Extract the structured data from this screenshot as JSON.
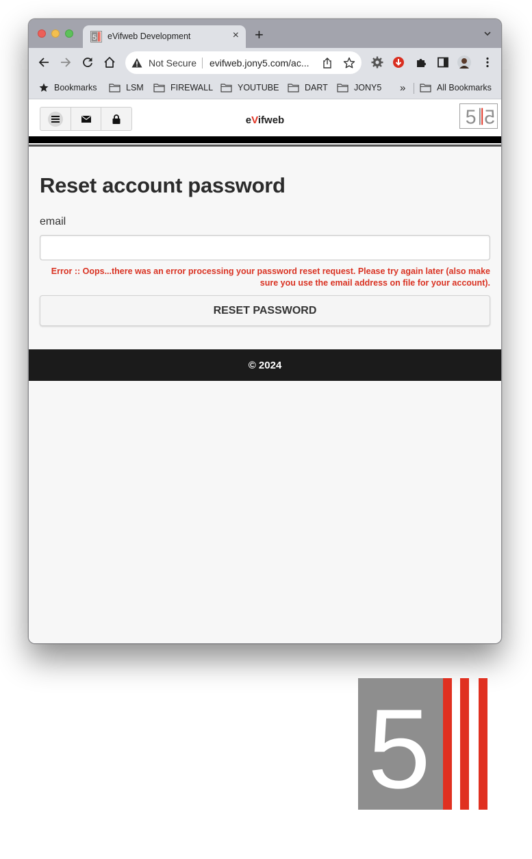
{
  "browser": {
    "tab": {
      "title": "eVifweb Development",
      "close": "×"
    },
    "new_tab": "+",
    "omnibox": {
      "security": "Not Secure",
      "url": "evifweb.jony5.com/ac..."
    },
    "bookmarks": [
      {
        "label": "Bookmarks",
        "icon": "star-icon"
      },
      {
        "label": "LSM",
        "icon": "folder-icon"
      },
      {
        "label": "FIREWALL",
        "icon": "folder-icon"
      },
      {
        "label": "YOUTUBE",
        "icon": "folder-icon"
      },
      {
        "label": "DART",
        "icon": "folder-icon"
      },
      {
        "label": "JONY5",
        "icon": "folder-icon"
      },
      {
        "label": "»",
        "icon": "overflow-chevron-icon"
      },
      {
        "label": "All Bookmarks",
        "icon": "folder-icon"
      }
    ]
  },
  "site": {
    "title_prefix": "e",
    "title_accent": "V",
    "title_suffix": "ifweb",
    "header_buttons": [
      "menu-icon",
      "mail-icon",
      "lock-icon"
    ],
    "logo_text": "5"
  },
  "form": {
    "heading": "Reset account password",
    "email_label": "email",
    "email_value": "",
    "error": "Error :: Oops...there was an error processing your password reset request. Please try again later (also make sure you use the email address on file for your account).",
    "submit_label": "RESET PASSWORD"
  },
  "footer": {
    "copyright": "© 2024"
  },
  "colors": {
    "accent_red": "#e03020",
    "error_red": "#d93222",
    "logo_gray": "#8e8e8e",
    "footer_bg": "#1b1b1b"
  }
}
